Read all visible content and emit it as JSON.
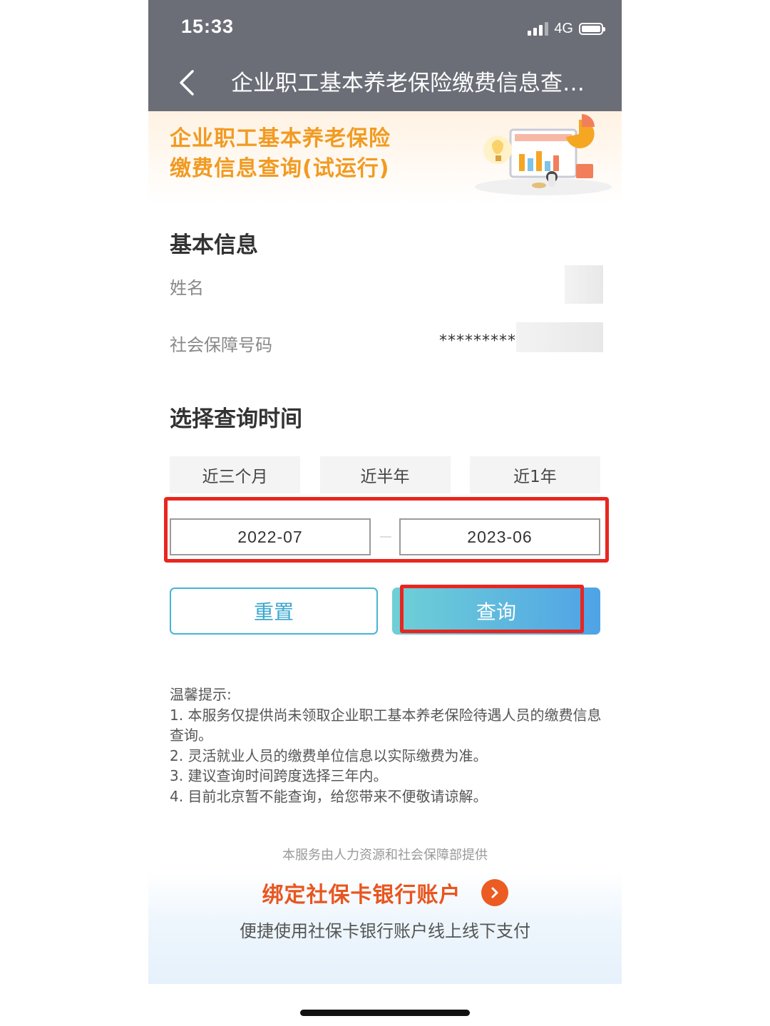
{
  "status_bar": {
    "time": "15:33",
    "network": "4G"
  },
  "navbar": {
    "title": "企业职工基本养老保险缴费信息查…"
  },
  "banner": {
    "title": "企业职工基本养老保险\n缴费信息查询(试运行)"
  },
  "basic_info": {
    "heading": "基本信息",
    "name_label": "姓名",
    "ssn_label": "社会保障号码",
    "ssn_value": "*********"
  },
  "query_time": {
    "heading": "选择查询时间",
    "ranges": [
      "近三个月",
      "近半年",
      "近1年"
    ],
    "start": "2022-07",
    "end": "2023-06"
  },
  "actions": {
    "reset": "重置",
    "query": "查询"
  },
  "tips": {
    "title": "温馨提示:",
    "items": [
      "1. 本服务仅提供尚未领取企业职工基本养老保险待遇人员的缴费信息查询。",
      "2. 灵活就业人员的缴费单位信息以实际缴费为准。",
      "3. 建议查询时间跨度选择三年内。",
      "4. 目前北京暂不能查询，给您带来不便敬请谅解。"
    ]
  },
  "footer": {
    "provider": "本服务由人力资源和社会保障部提供",
    "promo_title": "绑定社保卡银行账户",
    "promo_subtitle": "便捷使用社保卡银行账户线上线下支付"
  },
  "colors": {
    "header_bg": "#6b6e77",
    "banner_title": "#f19b22",
    "highlight": "#e8261f",
    "reset_border": "#45b4d6",
    "promo": "#e8561f"
  }
}
